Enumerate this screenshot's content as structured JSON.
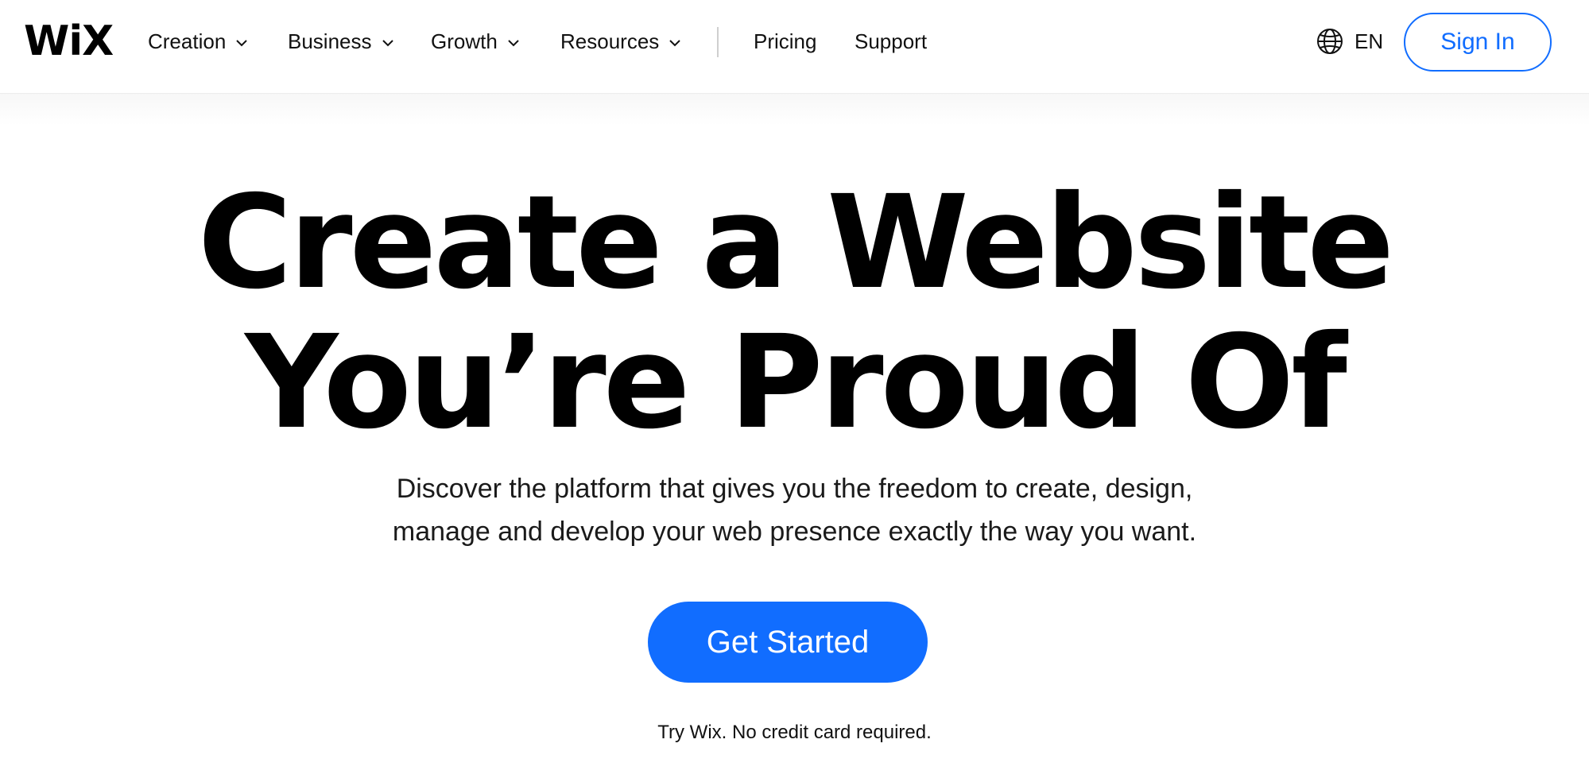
{
  "header": {
    "logo_text": "WiX",
    "nav": [
      {
        "label": "Creation",
        "dropdown": true
      },
      {
        "label": "Business",
        "dropdown": true
      },
      {
        "label": "Growth",
        "dropdown": true
      },
      {
        "label": "Resources",
        "dropdown": true
      },
      {
        "label": "Pricing",
        "dropdown": false
      },
      {
        "label": "Support",
        "dropdown": false
      }
    ],
    "language": {
      "label": "EN",
      "icon": "globe-icon"
    },
    "sign_in_label": "Sign In"
  },
  "hero": {
    "title_line1": "Create a Website",
    "title_line2": "You’re Proud Of",
    "subtitle_line1": "Discover the platform that gives you the freedom to create, design,",
    "subtitle_line2": "manage and develop your web presence exactly the way you want.",
    "cta_label": "Get Started",
    "note": "Try Wix. No credit card required."
  },
  "colors": {
    "accent": "#116dff",
    "text": "#000000",
    "background": "#ffffff"
  }
}
